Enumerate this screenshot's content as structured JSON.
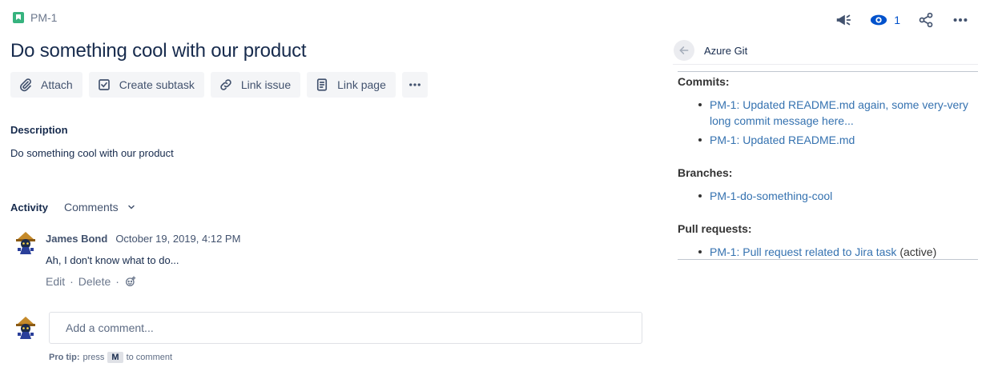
{
  "issue": {
    "key": "PM-1",
    "title": "Do something cool with our product"
  },
  "actions": {
    "attach": "Attach",
    "create_subtask": "Create subtask",
    "link_issue": "Link issue",
    "link_page": "Link page"
  },
  "description": {
    "label": "Description",
    "text": "Do something cool with our product"
  },
  "activity": {
    "label": "Activity",
    "filter": "Comments"
  },
  "comment": {
    "author": "James Bond",
    "time": "October 19, 2019, 4:12 PM",
    "body": "Ah, I don't know what to do...",
    "edit": "Edit",
    "delete": "Delete"
  },
  "add_comment": {
    "placeholder": "Add a comment...",
    "pro_tip_label": "Pro tip:",
    "pro_tip_press": "press",
    "pro_tip_key": "M",
    "pro_tip_suffix": "to comment"
  },
  "topbar": {
    "watch_count": "1"
  },
  "panel": {
    "title": "Azure Git",
    "commits_label": "Commits:",
    "commits": [
      "PM-1: Updated README.md again, some very-very long commit message here...",
      "PM-1: Updated README.md"
    ],
    "branches_label": "Branches:",
    "branches": [
      "PM-1-do-something-cool"
    ],
    "pr_label": "Pull requests:",
    "pull_requests": [
      {
        "title": "PM-1: Pull request related to Jira task",
        "status": "(active)"
      }
    ]
  },
  "colors": {
    "link": "#3572b0",
    "accent": "#0052cc",
    "story": "#36b37e"
  }
}
